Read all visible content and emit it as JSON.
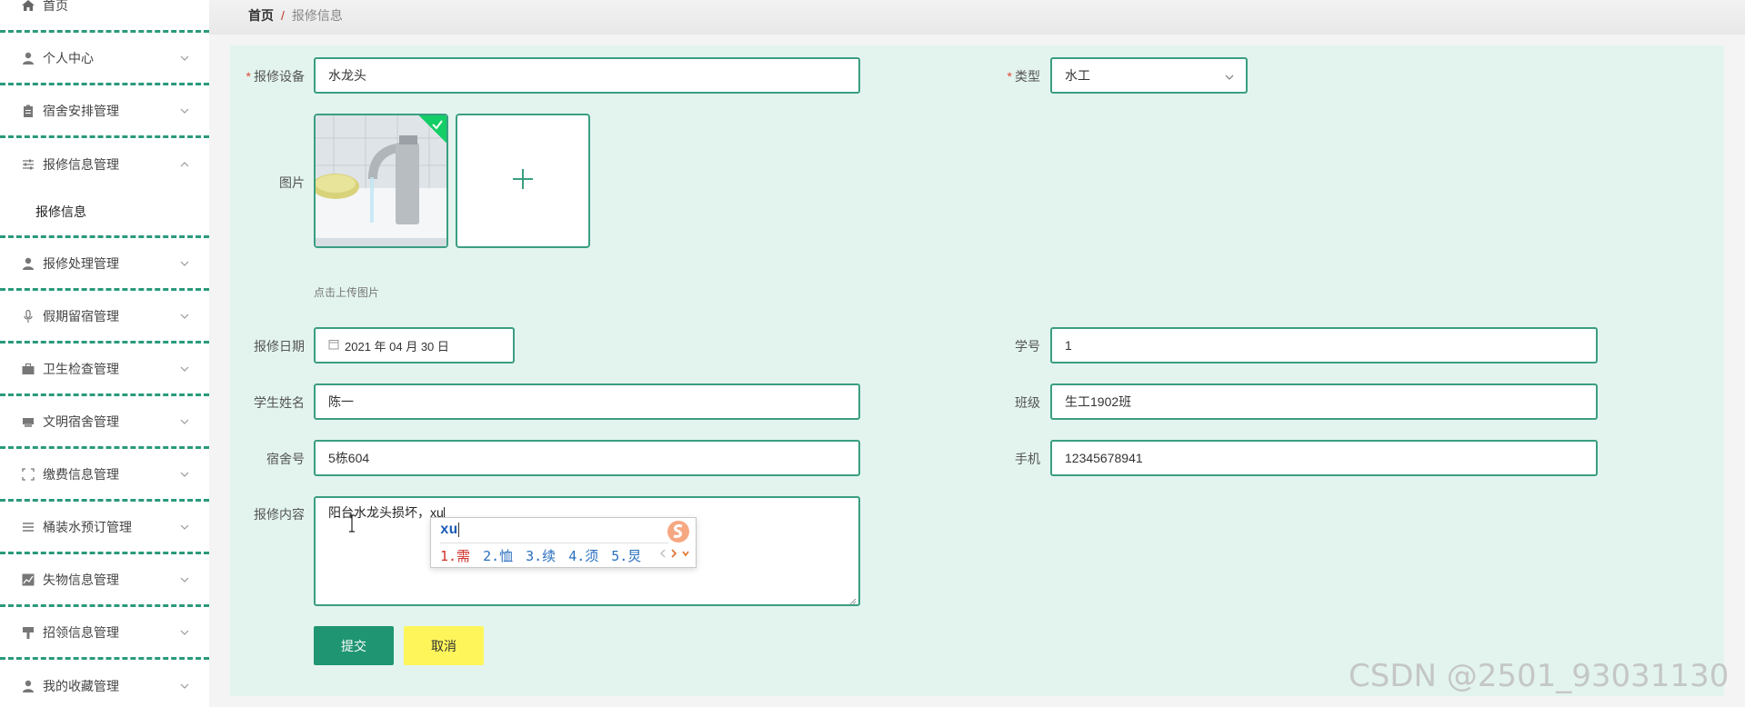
{
  "sidebar": {
    "items": [
      {
        "label": "首页",
        "icon": "home-icon",
        "expanded": null
      },
      {
        "label": "个人中心",
        "icon": "user-icon",
        "expanded": false
      },
      {
        "label": "宿舍安排管理",
        "icon": "clipboard-icon",
        "expanded": false
      },
      {
        "label": "报修信息管理",
        "icon": "sliders-icon",
        "expanded": true
      },
      {
        "label": "报修处理管理",
        "icon": "user-icon",
        "expanded": false
      },
      {
        "label": "假期留宿管理",
        "icon": "microphone-icon",
        "expanded": false
      },
      {
        "label": "卫生检查管理",
        "icon": "briefcase-icon",
        "expanded": false
      },
      {
        "label": "文明宿舍管理",
        "icon": "printer-icon",
        "expanded": false
      },
      {
        "label": "缴费信息管理",
        "icon": "fullscreen-icon",
        "expanded": false
      },
      {
        "label": "桶装水预订管理",
        "icon": "list-icon",
        "expanded": false
      },
      {
        "label": "失物信息管理",
        "icon": "chart-icon",
        "expanded": false
      },
      {
        "label": "招领信息管理",
        "icon": "brush-icon",
        "expanded": false
      },
      {
        "label": "我的收藏管理",
        "icon": "user-icon",
        "expanded": false
      }
    ],
    "submenu": {
      "label": "报修信息"
    }
  },
  "breadcrumb": {
    "home": "首页",
    "separator": "/",
    "current": "报修信息"
  },
  "form": {
    "device": {
      "label": "报修设备",
      "value": "水龙头",
      "required": true
    },
    "type": {
      "label": "类型",
      "value": "水工",
      "required": true
    },
    "image": {
      "label": "图片",
      "hint": "点击上传图片"
    },
    "date": {
      "label": "报修日期",
      "value": "2021 年 04 月 30 日"
    },
    "student_no": {
      "label": "学号",
      "value": "1"
    },
    "student_name": {
      "label": "学生姓名",
      "value": "陈一"
    },
    "class": {
      "label": "班级",
      "value": "生工1902班"
    },
    "dorm": {
      "label": "宿舍号",
      "value": "5栋604"
    },
    "phone": {
      "label": "手机",
      "value": "12345678941"
    },
    "content": {
      "label": "报修内容",
      "value": "阳台水龙头损坏，xu"
    }
  },
  "ime": {
    "pinyin": "xu",
    "candidates": [
      "1.需",
      "2.恤",
      "3.续",
      "4.须",
      "5.炅"
    ]
  },
  "buttons": {
    "submit": "提交",
    "cancel": "取消"
  },
  "colors": {
    "accent": "#1f9572",
    "border": "#3a9e82",
    "panel_bg": "#e3f4ee",
    "cancel_bg": "#fdf55a",
    "required": "#e04a3a"
  },
  "watermark": "CSDN @2501_93031130"
}
